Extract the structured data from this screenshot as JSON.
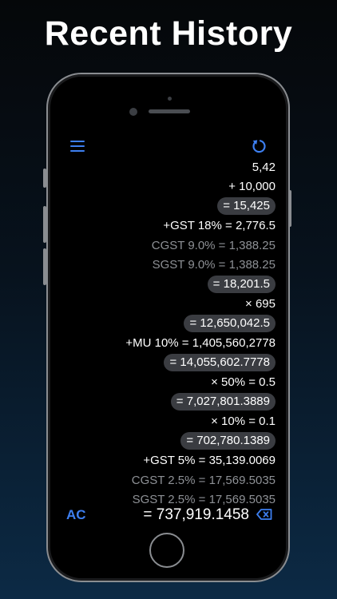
{
  "headline": "Recent History",
  "header": {
    "menu_icon": "hamburger-menu-icon",
    "undo_icon": "undo-icon"
  },
  "tape": [
    {
      "text": "5,42",
      "style": "plain"
    },
    {
      "text": "+ 10,000",
      "style": "plain"
    },
    {
      "text": "= 15,425",
      "style": "pill"
    },
    {
      "text": "+GST 18% = 2,776.5",
      "style": "plain"
    },
    {
      "text": "CGST 9.0% = 1,388.25",
      "style": "gray"
    },
    {
      "text": "SGST 9.0% = 1,388.25",
      "style": "gray"
    },
    {
      "text": "= 18,201.5",
      "style": "pill"
    },
    {
      "text": "× 695",
      "style": "plain"
    },
    {
      "text": "= 12,650,042.5",
      "style": "pill"
    },
    {
      "text": "+MU 10% = 1,405,560,2778",
      "style": "plain"
    },
    {
      "text": "= 14,055,602.7778",
      "style": "pill"
    },
    {
      "text": "× 50% = 0.5",
      "style": "plain"
    },
    {
      "text": "= 7,027,801.3889",
      "style": "pill"
    },
    {
      "text": "× 10% = 0.1",
      "style": "plain"
    },
    {
      "text": "= 702,780.1389",
      "style": "pill"
    },
    {
      "text": "+GST 5% = 35,139.0069",
      "style": "plain"
    },
    {
      "text": "CGST 2.5% = 17,569.5035",
      "style": "gray"
    },
    {
      "text": "SGST 2.5% = 17,569.5035",
      "style": "gray"
    }
  ],
  "footer": {
    "clear_label": "AC",
    "result": "= 737,919.1458",
    "backspace_icon": "backspace-icon"
  },
  "colors": {
    "accent": "#3d7ff0",
    "pill_background": "#3a3c41",
    "secondary_text": "#8e9196"
  }
}
